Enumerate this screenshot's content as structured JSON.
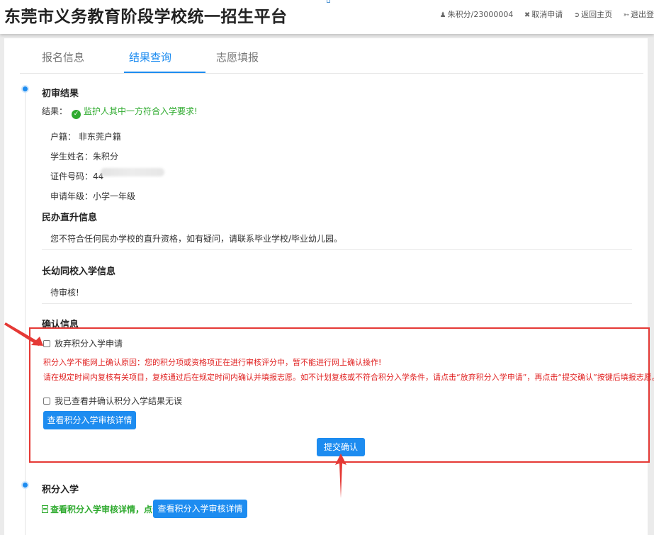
{
  "header": {
    "title": "东莞市义务教育阶段学校统一招生平台",
    "user_label": "朱积分/23000004",
    "cancel_label": "取消申请",
    "home_label": "返回主页",
    "logout_label": "退出登"
  },
  "tabs": [
    {
      "label": "报名信息"
    },
    {
      "label": "结果查询"
    },
    {
      "label": "志愿填报"
    }
  ],
  "prelim": {
    "title": "初审结果",
    "result_label": "结果：",
    "result_value": "监护人其中一方符合入学要求!",
    "hukou": "户籍：  非东莞户籍",
    "student": "学生姓名：朱积分",
    "id_label": "证件号码：44",
    "grade": "申请年级：小学一年级"
  },
  "private_school": {
    "title": "民办直升信息",
    "text": "您不符合任何民办学校的直升资格，如有疑问，请联系毕业学校/毕业幼儿园。"
  },
  "long_term": {
    "title": "长幼同校入学信息",
    "text": "待审核!"
  },
  "confirm": {
    "title": "确认信息",
    "abandon_label": "放弃积分入学申请",
    "reason_line1": "积分入学不能网上确认原因：您的积分项或资格项正在进行审核评分中，暂不能进行网上确认操作!",
    "reason_line2": "请在规定时间内复核有关项目，复核通过后在规定时间内确认并填报志愿。如不计划复核或不符合积分入学条件，请点击“放弃积分入学申请”，再点击“提交确认”按键后填报志愿。",
    "verified_label": "我已查看并确认积分入学结果无误",
    "view_button": "查看积分入学审核详情",
    "submit_button": "提交确认"
  },
  "points": {
    "title": "积分入学",
    "link_text": "查看积分入学审核详情，点击",
    "view_button": "查看积分入学审核详情"
  }
}
